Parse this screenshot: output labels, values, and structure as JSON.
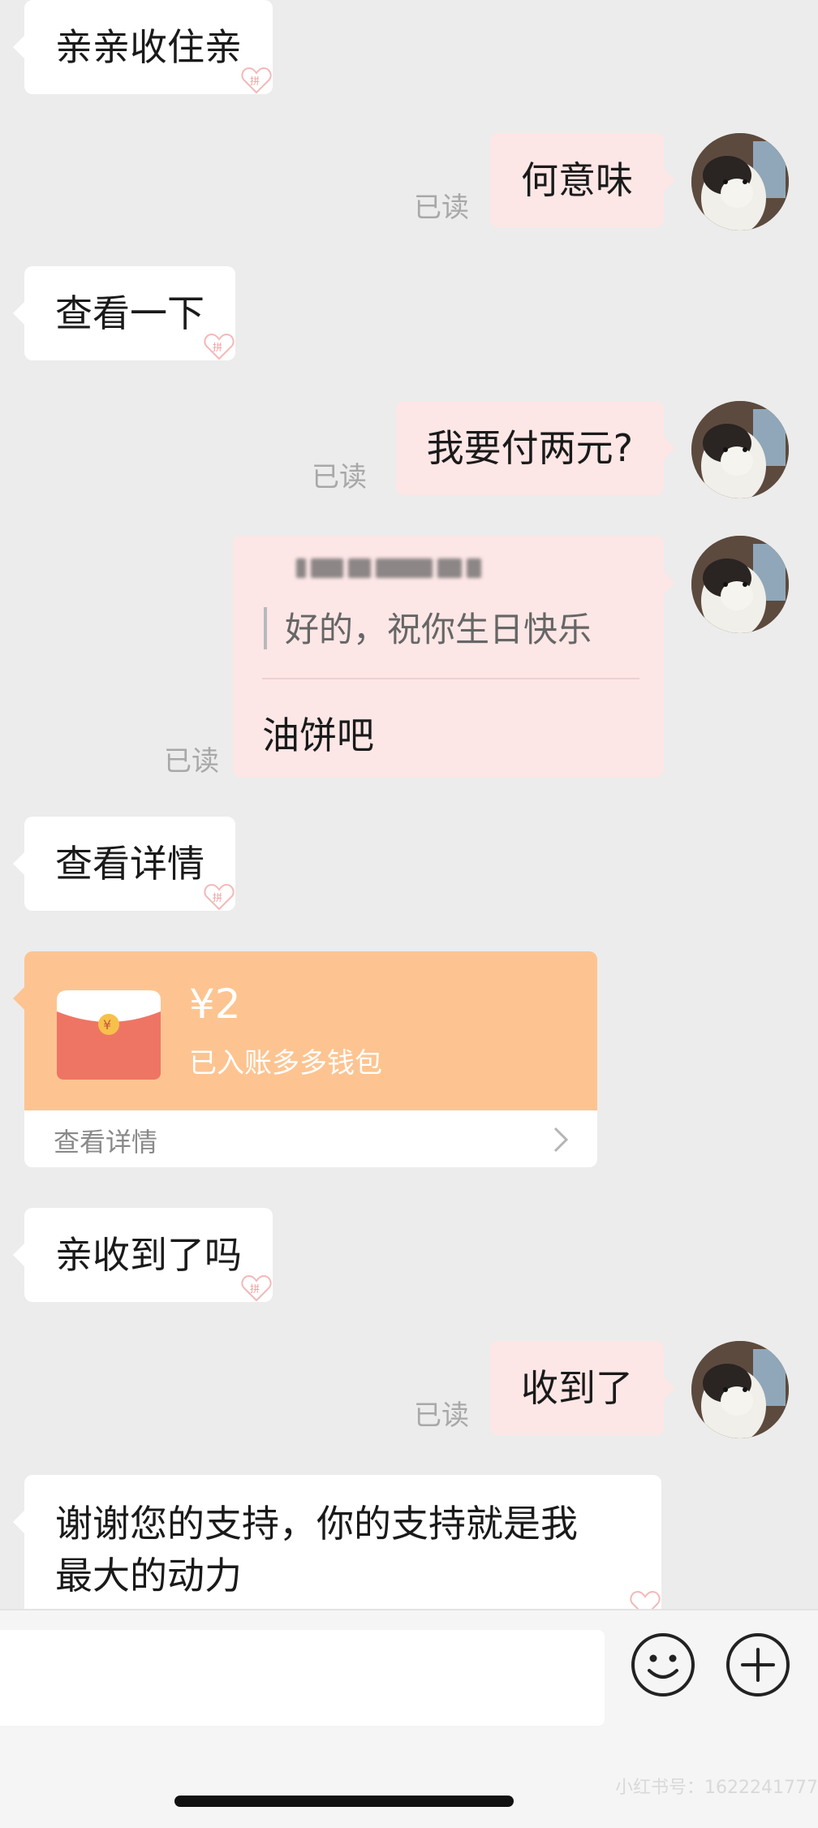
{
  "messages": {
    "m1": "亲亲收住亲",
    "m2": "何意味",
    "m3": "查看一下",
    "m4": "我要付两元?",
    "m5_quote": "好的，祝你生日快乐",
    "m5_reply": "油饼吧",
    "m6": "查看详情",
    "m8": "亲收到了吗",
    "m9": "收到了",
    "m10_line1": "谢谢您的支持，你的支持就是我",
    "m10_line2": "最大的动力"
  },
  "read_receipt": "已读",
  "red_packet": {
    "amount": "¥2",
    "status": "已入账多多钱包",
    "detail_link": "查看详情"
  },
  "input": {
    "placeholder": ""
  },
  "watermark": "小红书号：1622241777",
  "colors": {
    "background": "#ececec",
    "incoming_bubble": "#ffffff",
    "outgoing_bubble": "#fde6e6",
    "red_packet_top": "#fdc491",
    "red_packet_envelope": "#ee7564"
  }
}
